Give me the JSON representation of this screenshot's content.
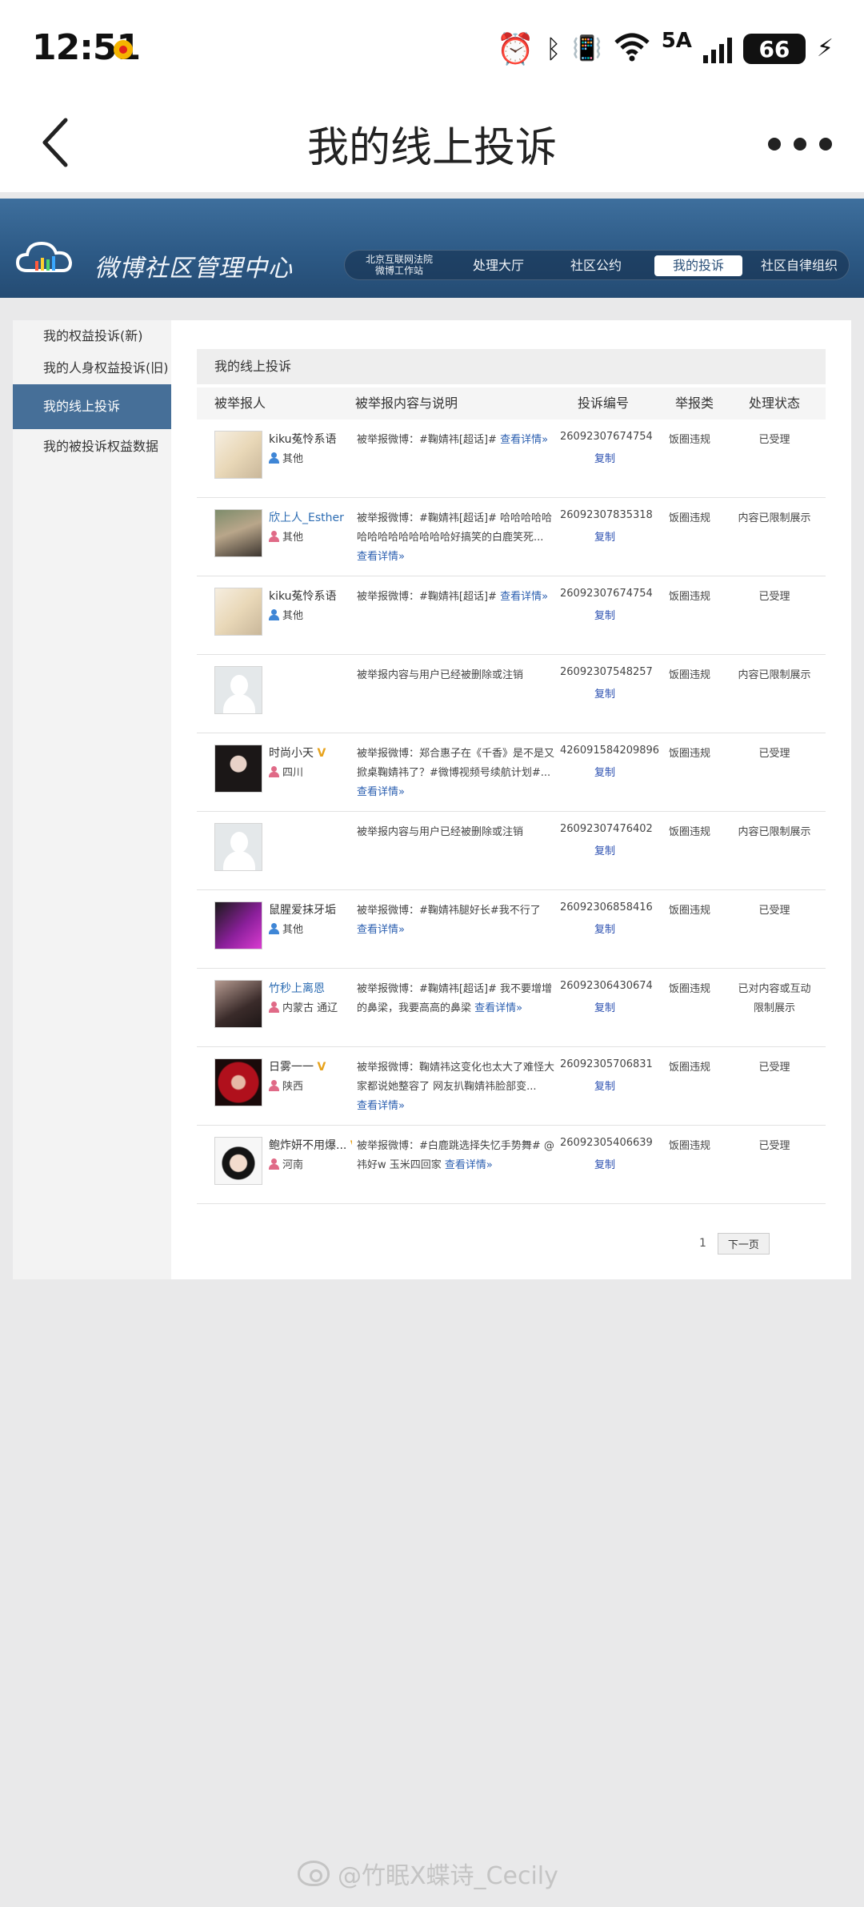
{
  "status_bar": {
    "time": "12:51",
    "network": "5A",
    "battery": "66"
  },
  "header": {
    "title": "我的线上投诉"
  },
  "banner": {
    "site_title": "微博社区管理中心",
    "org_line1": "北京互联网法院",
    "org_line2": "微博工作站",
    "nav": [
      "处理大厅",
      "社区公约",
      "我的投诉",
      "社区自律组织"
    ],
    "active_nav": "我的投诉"
  },
  "sidebar": {
    "items": [
      "我的权益投诉(新)",
      "我的人身权益投诉(旧)",
      "我的线上投诉",
      "我的被投诉权益数据"
    ]
  },
  "main": {
    "section_title": "我的线上投诉",
    "columns": [
      "被举报人",
      "被举报内容与说明",
      "投诉编号",
      "举报类",
      "处理状态"
    ],
    "copy_label": "复制",
    "rows": [
      {
        "user": "kiku菟怜系语",
        "location": "其他",
        "content": "被举报微博：#鞠婧祎[超话]#",
        "detail": "查看详情»",
        "id": "26092307674754",
        "type": "饭圈违规",
        "status": "已受理"
      },
      {
        "user": "欣上人_Esther",
        "location": "其他",
        "content": "被举报微博：#鞠婧祎[超话]# 哈哈哈哈哈哈哈哈哈哈哈哈哈哈好搞笑的白鹿笑死...",
        "detail": "查看详情»",
        "id": "26092307835318",
        "type": "饭圈违规",
        "status": "内容已限制展示"
      },
      {
        "user": "kiku菟怜系语",
        "location": "其他",
        "content": "被举报微博：#鞠婧祎[超话]#",
        "detail": "查看详情»",
        "id": "26092307674754",
        "type": "饭圈违规",
        "status": "已受理"
      },
      {
        "user": "",
        "location": "",
        "content": "被举报内容与用户已经被删除或注销",
        "detail": "",
        "id": "26092307548257",
        "type": "饭圈违规",
        "status": "内容已限制展示"
      },
      {
        "user": "时尚小天",
        "location": "四川",
        "content": "被举报微博：郑合惠子在《千香》是不是又掀桌鞠婧祎了？#微博视频号续航计划#...",
        "detail": "查看详情»",
        "id": "426091584209896",
        "type": "饭圈违规",
        "status": "已受理"
      },
      {
        "user": "",
        "location": "",
        "content": "被举报内容与用户已经被删除或注销",
        "detail": "",
        "id": "26092307476402",
        "type": "饭圈违规",
        "status": "内容已限制展示"
      },
      {
        "user": "鼠腥爱抹牙垢",
        "location": "其他",
        "content": "被举报微博：#鞠婧祎腿好长#我不行了",
        "detail": "查看详情»",
        "id": "26092306858416",
        "type": "饭圈违规",
        "status": "已受理"
      },
      {
        "user": "竹秒上离恩",
        "location": "内蒙古 通辽",
        "content": "被举报微博：#鞠婧祎[超话]# 我不要增增的鼻梁，我要高高的鼻梁",
        "detail": "查看详情»",
        "id": "26092306430674",
        "type": "饭圈违规",
        "status": "已对内容或互动限制展示"
      },
      {
        "user": "日雾一一",
        "location": "陕西",
        "content": "被举报微博：鞠婧祎这变化也太大了难怪大家都说她整容了 网友扒鞠婧祎脸部变...",
        "detail": "查看详情»",
        "id": "26092305706831",
        "type": "饭圈违规",
        "status": "已受理"
      },
      {
        "user": "鲍炸妍不用爆...",
        "location": "河南",
        "content": "被举报微博：#白鹿跳选择失忆手势舞# @祎好w 玉米四回家",
        "detail": "查看详情»",
        "id": "26092305406639",
        "type": "饭圈违规",
        "status": "已受理"
      }
    ]
  },
  "pager": {
    "current": "1",
    "next": "下一页"
  },
  "watermark": "@竹眠X蝶诗_Cecily"
}
